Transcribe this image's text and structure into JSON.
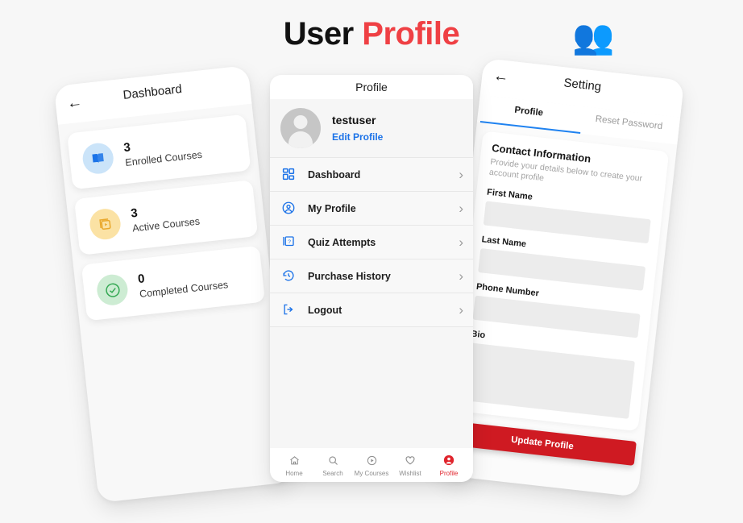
{
  "header": {
    "title_primary": "User ",
    "title_accent": "Profile",
    "emoji": "👥",
    "emoji_name": "people-group-emoji",
    "accent_color": "#ef4044"
  },
  "phone_left": {
    "appbar": {
      "back_icon": "←",
      "title": "Dashboard"
    },
    "stats": [
      {
        "count": "3",
        "label": "Enrolled Courses",
        "icon": "book-icon",
        "bubble_color": "#cbe4f9",
        "icon_color": "#1a73e8"
      },
      {
        "count": "3",
        "label": "Active Courses",
        "icon": "video-library-icon",
        "bubble_color": "#fbe2a4",
        "icon_color": "#e9a82c"
      },
      {
        "count": "0",
        "label": "Completed Courses",
        "icon": "check-circle-icon",
        "bubble_color": "#cdecd3",
        "icon_color": "#34a853"
      }
    ]
  },
  "phone_center": {
    "appbar": {
      "title": "Profile"
    },
    "user": {
      "name": "testuser",
      "edit_link": "Edit Profile",
      "avatar": "default-avatar"
    },
    "menu": [
      {
        "label": "Dashboard",
        "icon": "dashboard-grid-icon",
        "chevron": "›"
      },
      {
        "label": "My Profile",
        "icon": "account-circle-icon",
        "chevron": "›"
      },
      {
        "label": "Quiz Attempts",
        "icon": "quiz-icon",
        "chevron": "›"
      },
      {
        "label": "Purchase History",
        "icon": "history-icon",
        "chevron": "›"
      },
      {
        "label": "Logout",
        "icon": "logout-icon",
        "chevron": "›"
      }
    ],
    "bottom_nav": [
      {
        "label": "Home",
        "icon": "home-icon",
        "active": false
      },
      {
        "label": "Search",
        "icon": "search-icon",
        "active": false
      },
      {
        "label": "My Courses",
        "icon": "play-circle-icon",
        "active": false
      },
      {
        "label": "Wishlist",
        "icon": "heart-icon",
        "active": false
      },
      {
        "label": "Profile",
        "icon": "account-circle-filled-icon",
        "active": true
      }
    ],
    "active_color": "#e0242c",
    "link_color": "#1b72e8"
  },
  "phone_right": {
    "appbar": {
      "back_icon": "←",
      "title": "Setting"
    },
    "tabs": [
      {
        "label": "Profile",
        "active": true
      },
      {
        "label": "Reset Password",
        "active": false
      }
    ],
    "tab_underline_color": "#1f82f0",
    "form": {
      "heading": "Contact Information",
      "subtext": "Provide your details below to create your account profile",
      "fields": [
        {
          "label": "First Name",
          "value": "",
          "multiline": false
        },
        {
          "label": "Last Name",
          "value": "",
          "multiline": false
        },
        {
          "label": "Phone Number",
          "value": "",
          "multiline": false
        },
        {
          "label": "Bio",
          "value": "",
          "multiline": true
        }
      ],
      "submit_label": "Update Profile",
      "submit_color": "#cf1a22"
    }
  }
}
